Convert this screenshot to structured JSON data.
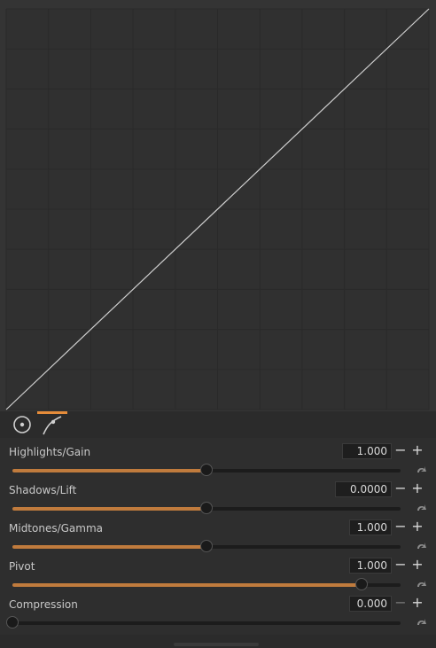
{
  "curve_editor": {
    "grid_columns": 10,
    "grid_rows": 10,
    "background": "#343434",
    "grid_color": "#2a2a2a",
    "curve_color": "#d0d0d0",
    "curve": "linear identity"
  },
  "tools": [
    {
      "name": "target-icon",
      "active": false
    },
    {
      "name": "curve-icon",
      "active": true
    }
  ],
  "accent": "#e58c3a",
  "controls": [
    {
      "label": "Highlights/Gain",
      "value": "1.000",
      "fraction": 0.5,
      "minus_enabled": true
    },
    {
      "label": "Shadows/Lift",
      "value": "0.0000",
      "fraction": 0.5,
      "minus_enabled": true
    },
    {
      "label": "Midtones/Gamma",
      "value": "1.000",
      "fraction": 0.5,
      "minus_enabled": true
    },
    {
      "label": "Pivot",
      "value": "1.000",
      "fraction": 0.9,
      "minus_enabled": true
    },
    {
      "label": "Compression",
      "value": "0.000",
      "fraction": 0.0,
      "minus_enabled": false
    }
  ],
  "minus_symbol": "−",
  "plus_symbol": "+"
}
